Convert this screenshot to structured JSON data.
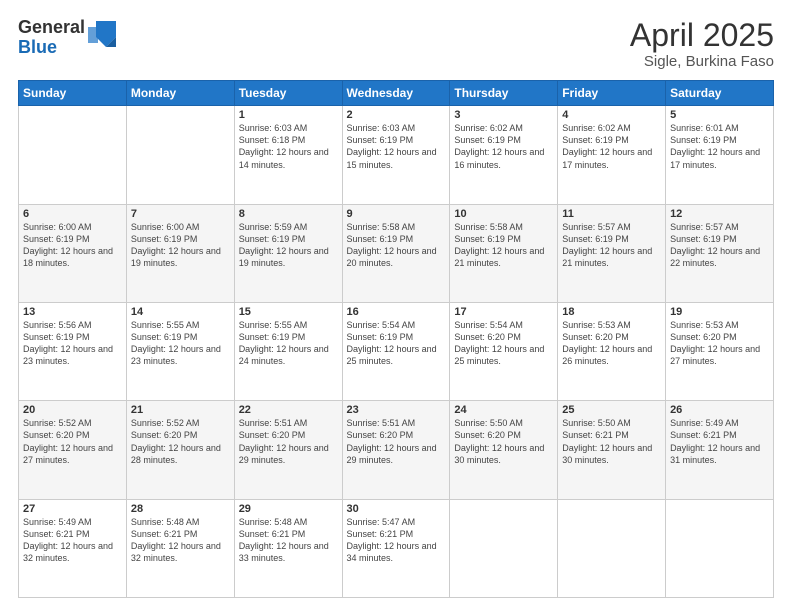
{
  "logo": {
    "general": "General",
    "blue": "Blue"
  },
  "title": "April 2025",
  "subtitle": "Sigle, Burkina Faso",
  "days_of_week": [
    "Sunday",
    "Monday",
    "Tuesday",
    "Wednesday",
    "Thursday",
    "Friday",
    "Saturday"
  ],
  "weeks": [
    [
      {
        "day": "",
        "info": ""
      },
      {
        "day": "",
        "info": ""
      },
      {
        "day": "1",
        "info": "Sunrise: 6:03 AM\nSunset: 6:18 PM\nDaylight: 12 hours and 14 minutes."
      },
      {
        "day": "2",
        "info": "Sunrise: 6:03 AM\nSunset: 6:19 PM\nDaylight: 12 hours and 15 minutes."
      },
      {
        "day": "3",
        "info": "Sunrise: 6:02 AM\nSunset: 6:19 PM\nDaylight: 12 hours and 16 minutes."
      },
      {
        "day": "4",
        "info": "Sunrise: 6:02 AM\nSunset: 6:19 PM\nDaylight: 12 hours and 17 minutes."
      },
      {
        "day": "5",
        "info": "Sunrise: 6:01 AM\nSunset: 6:19 PM\nDaylight: 12 hours and 17 minutes."
      }
    ],
    [
      {
        "day": "6",
        "info": "Sunrise: 6:00 AM\nSunset: 6:19 PM\nDaylight: 12 hours and 18 minutes."
      },
      {
        "day": "7",
        "info": "Sunrise: 6:00 AM\nSunset: 6:19 PM\nDaylight: 12 hours and 19 minutes."
      },
      {
        "day": "8",
        "info": "Sunrise: 5:59 AM\nSunset: 6:19 PM\nDaylight: 12 hours and 19 minutes."
      },
      {
        "day": "9",
        "info": "Sunrise: 5:58 AM\nSunset: 6:19 PM\nDaylight: 12 hours and 20 minutes."
      },
      {
        "day": "10",
        "info": "Sunrise: 5:58 AM\nSunset: 6:19 PM\nDaylight: 12 hours and 21 minutes."
      },
      {
        "day": "11",
        "info": "Sunrise: 5:57 AM\nSunset: 6:19 PM\nDaylight: 12 hours and 21 minutes."
      },
      {
        "day": "12",
        "info": "Sunrise: 5:57 AM\nSunset: 6:19 PM\nDaylight: 12 hours and 22 minutes."
      }
    ],
    [
      {
        "day": "13",
        "info": "Sunrise: 5:56 AM\nSunset: 6:19 PM\nDaylight: 12 hours and 23 minutes."
      },
      {
        "day": "14",
        "info": "Sunrise: 5:55 AM\nSunset: 6:19 PM\nDaylight: 12 hours and 23 minutes."
      },
      {
        "day": "15",
        "info": "Sunrise: 5:55 AM\nSunset: 6:19 PM\nDaylight: 12 hours and 24 minutes."
      },
      {
        "day": "16",
        "info": "Sunrise: 5:54 AM\nSunset: 6:19 PM\nDaylight: 12 hours and 25 minutes."
      },
      {
        "day": "17",
        "info": "Sunrise: 5:54 AM\nSunset: 6:20 PM\nDaylight: 12 hours and 25 minutes."
      },
      {
        "day": "18",
        "info": "Sunrise: 5:53 AM\nSunset: 6:20 PM\nDaylight: 12 hours and 26 minutes."
      },
      {
        "day": "19",
        "info": "Sunrise: 5:53 AM\nSunset: 6:20 PM\nDaylight: 12 hours and 27 minutes."
      }
    ],
    [
      {
        "day": "20",
        "info": "Sunrise: 5:52 AM\nSunset: 6:20 PM\nDaylight: 12 hours and 27 minutes."
      },
      {
        "day": "21",
        "info": "Sunrise: 5:52 AM\nSunset: 6:20 PM\nDaylight: 12 hours and 28 minutes."
      },
      {
        "day": "22",
        "info": "Sunrise: 5:51 AM\nSunset: 6:20 PM\nDaylight: 12 hours and 29 minutes."
      },
      {
        "day": "23",
        "info": "Sunrise: 5:51 AM\nSunset: 6:20 PM\nDaylight: 12 hours and 29 minutes."
      },
      {
        "day": "24",
        "info": "Sunrise: 5:50 AM\nSunset: 6:20 PM\nDaylight: 12 hours and 30 minutes."
      },
      {
        "day": "25",
        "info": "Sunrise: 5:50 AM\nSunset: 6:21 PM\nDaylight: 12 hours and 30 minutes."
      },
      {
        "day": "26",
        "info": "Sunrise: 5:49 AM\nSunset: 6:21 PM\nDaylight: 12 hours and 31 minutes."
      }
    ],
    [
      {
        "day": "27",
        "info": "Sunrise: 5:49 AM\nSunset: 6:21 PM\nDaylight: 12 hours and 32 minutes."
      },
      {
        "day": "28",
        "info": "Sunrise: 5:48 AM\nSunset: 6:21 PM\nDaylight: 12 hours and 32 minutes."
      },
      {
        "day": "29",
        "info": "Sunrise: 5:48 AM\nSunset: 6:21 PM\nDaylight: 12 hours and 33 minutes."
      },
      {
        "day": "30",
        "info": "Sunrise: 5:47 AM\nSunset: 6:21 PM\nDaylight: 12 hours and 34 minutes."
      },
      {
        "day": "",
        "info": ""
      },
      {
        "day": "",
        "info": ""
      },
      {
        "day": "",
        "info": ""
      }
    ]
  ]
}
